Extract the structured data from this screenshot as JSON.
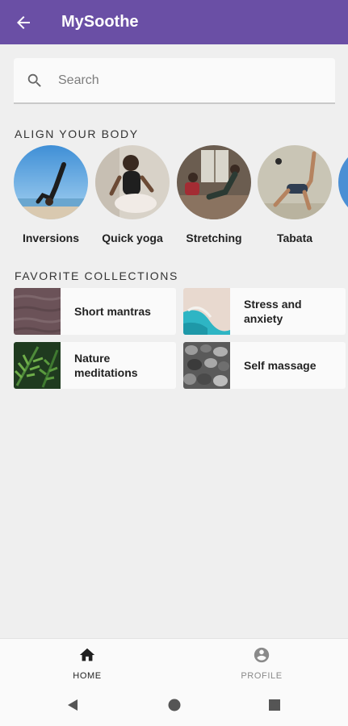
{
  "appbar": {
    "title": "MySoothe",
    "back_icon": "arrow-back-icon",
    "color": "#6a4fa5"
  },
  "search": {
    "placeholder": "Search",
    "value": "",
    "icon": "search-icon"
  },
  "align_body": {
    "header": "ALIGN YOUR BODY",
    "items": [
      {
        "label": "Inversions"
      },
      {
        "label": "Quick yoga"
      },
      {
        "label": "Stretching"
      },
      {
        "label": "Tabata"
      },
      {
        "label": ""
      }
    ]
  },
  "collections": {
    "header": "FAVORITE COLLECTIONS",
    "items": [
      {
        "label": "Short mantras"
      },
      {
        "label": "Stress and anxiety"
      },
      {
        "label": "Nature meditations"
      },
      {
        "label": "Self massage"
      }
    ]
  },
  "bottom_nav": {
    "items": [
      {
        "label": "HOME",
        "icon": "home-icon",
        "selected": true
      },
      {
        "label": "PROFILE",
        "icon": "account-circle-icon",
        "selected": false
      }
    ]
  },
  "system_nav": {
    "icons": [
      "back-triangle-icon",
      "home-circle-icon",
      "recents-square-icon"
    ]
  }
}
